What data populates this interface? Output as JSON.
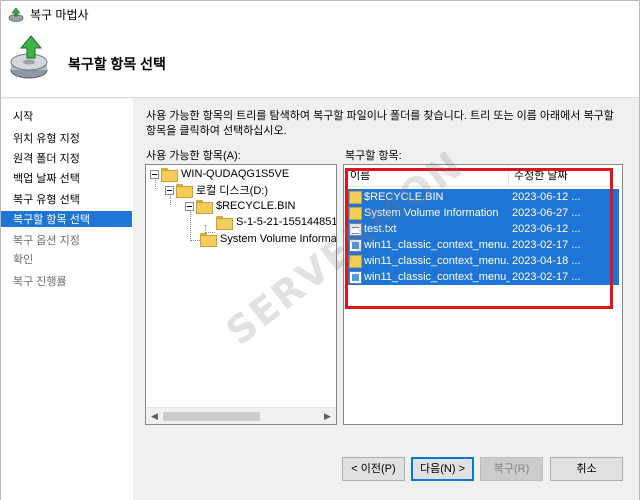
{
  "window": {
    "title": "복구 마법사"
  },
  "header": {
    "page_title": "복구할 항목 선택"
  },
  "sidebar": {
    "items": [
      {
        "label": "시작",
        "state": "normal"
      },
      {
        "label": "위치 유형 지정",
        "state": "normal"
      },
      {
        "label": "원격 폴더 지정",
        "state": "normal"
      },
      {
        "label": "백업 날짜 선택",
        "state": "normal"
      },
      {
        "label": "복구 유형 선택",
        "state": "normal"
      },
      {
        "label": "복구할 항목 선택",
        "state": "active"
      },
      {
        "label": "복구 옵션 지정",
        "state": "dim"
      },
      {
        "label": "확인",
        "state": "dim"
      },
      {
        "label": "복구 진행률",
        "state": "dim"
      }
    ]
  },
  "content": {
    "description": "사용 가능한 항목의 트리를 탐색하여 복구할 파일이나 폴더를 찾습니다. 트리 또는 이름 아래에서 복구할 항목을 클릭하여 선택하십시오.",
    "available_label": "사용 가능한 항목(A):",
    "restore_label": "복구할 항목:"
  },
  "tree": {
    "nodes": [
      {
        "label": "WIN-QUDAQG1S5VE"
      },
      {
        "label": "로컬 디스크(D:)"
      },
      {
        "label": "$RECYCLE.BIN"
      },
      {
        "label": "S-1-5-21-155144851"
      },
      {
        "label": "System Volume Informati"
      }
    ]
  },
  "list": {
    "columns": {
      "name": "이름",
      "date": "수정한 날짜"
    },
    "rows": [
      {
        "name": "$RECYCLE.BIN",
        "date": "2023-06-12 ...",
        "icon": "folder-icon"
      },
      {
        "name": "System Volume Information",
        "date": "2023-06-27 ...",
        "icon": "folder-icon"
      },
      {
        "name": "test.txt",
        "date": "2023-06-12 ...",
        "icon": "text-file-icon"
      },
      {
        "name": "win11_classic_context_menu...",
        "date": "2023-02-17 ...",
        "icon": "image-file-icon"
      },
      {
        "name": "win11_classic_context_menu...",
        "date": "2023-04-18 ...",
        "icon": "folder-icon"
      },
      {
        "name": "win11_classic_context_menu_...",
        "date": "2023-02-17 ...",
        "icon": "image-file-icon"
      }
    ]
  },
  "buttons": {
    "back": "< 이전(P)",
    "next": "다음(N) >",
    "restore": "복구(R)",
    "cancel": "취소"
  },
  "watermark": "SERVERMON",
  "colors": {
    "selection": "#1f75d6",
    "highlight_box": "#e3131b"
  }
}
